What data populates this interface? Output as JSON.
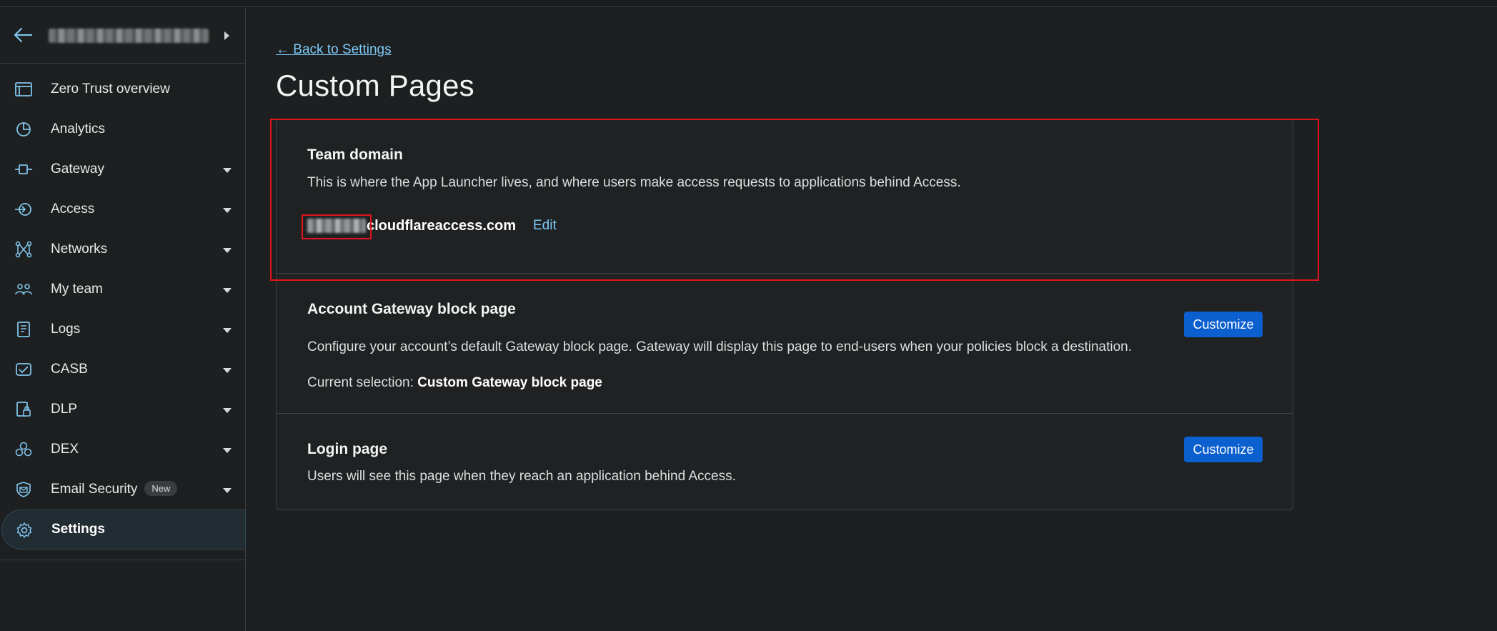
{
  "sidebar": {
    "account_name": "",
    "items": [
      {
        "label": "Zero Trust overview",
        "icon": "browser-window-icon",
        "has_caret": false
      },
      {
        "label": "Analytics",
        "icon": "pie-chart-icon",
        "has_caret": false
      },
      {
        "label": "Gateway",
        "icon": "gateway-icon",
        "has_caret": true
      },
      {
        "label": "Access",
        "icon": "access-icon",
        "has_caret": true
      },
      {
        "label": "Networks",
        "icon": "network-icon",
        "has_caret": true
      },
      {
        "label": "My team",
        "icon": "people-icon",
        "has_caret": true
      },
      {
        "label": "Logs",
        "icon": "logs-icon",
        "has_caret": true
      },
      {
        "label": "CASB",
        "icon": "casb-icon",
        "has_caret": true
      },
      {
        "label": "DLP",
        "icon": "dlp-icon",
        "has_caret": true
      },
      {
        "label": "DEX",
        "icon": "dex-icon",
        "has_caret": true
      },
      {
        "label": "Email Security",
        "badge": "New",
        "icon": "email-security-icon",
        "has_caret": true
      },
      {
        "label": "Settings",
        "icon": "gear-icon",
        "has_caret": false,
        "active": true
      }
    ]
  },
  "main": {
    "back_link": "← Back to Settings",
    "title": "Custom Pages",
    "team_domain": {
      "title": "Team domain",
      "description": "This is where the App Launcher lives, and where users make access requests to applications behind Access.",
      "domain_suffix": "cloudflareaccess.com",
      "edit_label": "Edit"
    },
    "gateway_block": {
      "title": "Account Gateway block page",
      "description": "Configure your account’s default Gateway block page. Gateway will display this page to end-users when your policies block a destination.",
      "current_prefix": "Current selection: ",
      "current_value": "Custom Gateway block page",
      "button": "Customize"
    },
    "login_page": {
      "title": "Login page",
      "description": "Users will see this page when they reach an application behind Access.",
      "button": "Customize"
    }
  },
  "colors": {
    "background": "#1d1f20",
    "link": "#7bc8f6",
    "accent_button": "#0b5fce",
    "highlight": "#e0151c",
    "icon": "#7fc4ea"
  }
}
